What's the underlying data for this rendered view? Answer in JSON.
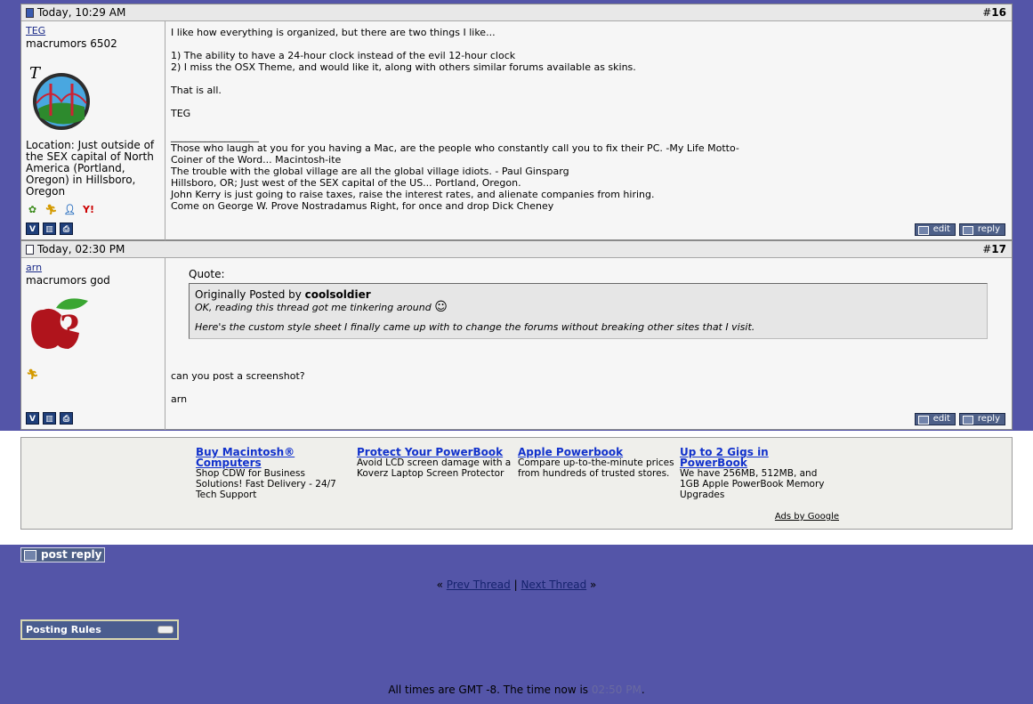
{
  "posts": [
    {
      "date": "Today, 10:29 AM",
      "number_prefix": "#",
      "number": "16",
      "username": "TEG",
      "user_title": "macrumors 6502",
      "location": "Location: Just outside of the SEX capital of North America (Portland, Oregon) in Hillsboro, Oregon",
      "message": "I like how everything is organized, but there are two things I like...\n\n1) The ability to have a 24-hour clock instead of the evil 12-hour clock\n2) I miss the OSX Theme, and would like it, along with others similar forums available as skins.\n\nThat is all.\n\nTEG",
      "signature": "__________________\nThose who laugh at you for you having a Mac, are the people who constantly call you to fix their PC. -My Life Motto-\nCoiner of the Word... Macintosh-ite\nThe trouble with the global village are all the global village idiots. - Paul Ginsparg\nHillsboro, OR; Just west of the SEX capital of the US... Portland, Oregon.\nJohn Kerry is just going to raise taxes, raise the interest rates, and alienate companies from hiring.\nCome on George W. Prove Nostradamus Right, for once and drop Dick Cheney"
    },
    {
      "date": "Today, 02:30 PM",
      "number_prefix": "#",
      "number": "17",
      "username": "arn",
      "user_title": "macrumors god",
      "quote_label": "Quote:",
      "quote_prefix": "Originally Posted by ",
      "quote_author": "coolsoldier",
      "quote_line1": "OK, reading this thread got me tinkering around",
      "quote_line2": "Here's the custom style sheet I finally came up with to change the forums without breaking other sites that I visit.",
      "message": "can you post a screenshot?\n\narn"
    }
  ],
  "buttons": {
    "edit": "edit",
    "reply": "reply",
    "post_reply": "post reply"
  },
  "ads": {
    "items": [
      {
        "title": "Buy Macintosh® Computers",
        "text": "Shop CDW for Business Solutions! Fast Delivery - 24/7 Tech Support"
      },
      {
        "title": "Protect Your PowerBook",
        "text": "Avoid LCD screen damage with a Koverz Laptop Screen Protector"
      },
      {
        "title": "Apple Powerbook",
        "text": "Compare up-to-the-minute prices from hundreds of trusted stores."
      },
      {
        "title": "Up to 2 Gigs in PowerBook",
        "text": "We have 256MB, 512MB, and 1GB Apple PowerBook Memory Upgrades"
      }
    ],
    "by_label": "Ads by Google"
  },
  "nav": {
    "prev": "Prev Thread",
    "sep": "|",
    "next": "Next Thread",
    "left_arrows": "«",
    "right_arrows": "»"
  },
  "rules": {
    "title": "Posting Rules"
  },
  "footer": {
    "text": "All times are GMT -8. The time now is ",
    "time": "02:50 PM",
    "end": "."
  },
  "colors": {
    "page_bg": "#5455a8",
    "post_bg": "#f6f6f6",
    "link": "#1232cc"
  }
}
